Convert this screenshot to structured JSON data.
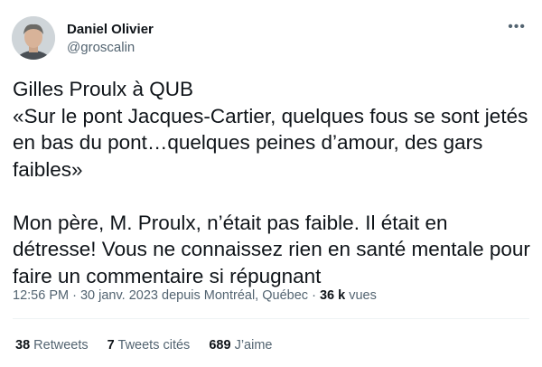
{
  "author": {
    "name": "Daniel Olivier",
    "handle": "@groscalin"
  },
  "more_icon": "more-horizontal-icon",
  "tweet": {
    "line1": "Gilles Proulx à QUB",
    "line2": "«Sur le pont Jacques-Cartier, quelques fous se sont jetés en bas du pont…quelques peines d’amour, des gars faibles»",
    "line3": "Mon père, M. Proulx, n’était pas faible. Il était en détresse! Vous ne connaissez rien en santé mentale pour faire un commentaire si répugnant"
  },
  "meta": {
    "time": "12:56 PM",
    "date": "30 janv. 2023",
    "location": "depuis Montréal, Québec",
    "views_count": "36 k",
    "views_label": "vues"
  },
  "stats": {
    "retweets_count": "38",
    "retweets_label": "Retweets",
    "quotes_count": "7",
    "quotes_label": "Tweets cités",
    "likes_count": "689",
    "likes_label": "J’aime"
  }
}
